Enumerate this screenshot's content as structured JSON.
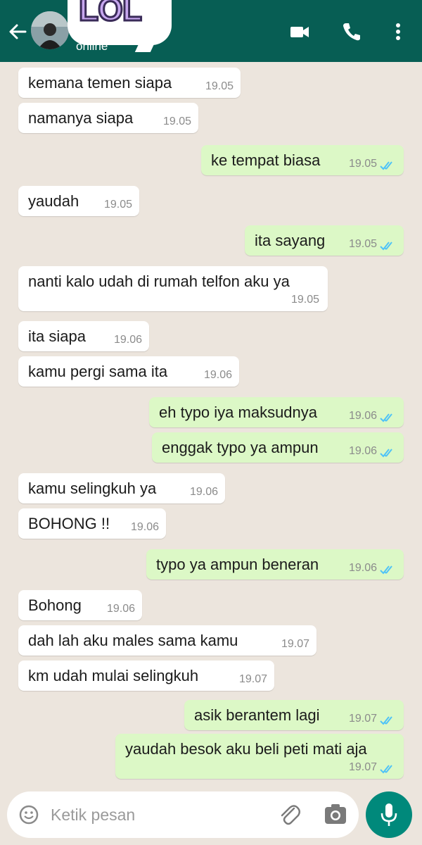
{
  "header": {
    "status": "online",
    "sticker_text": "LOL",
    "icons": [
      "back-arrow-icon",
      "video-call-icon",
      "voice-call-icon",
      "more-options-icon"
    ]
  },
  "messages": [
    {
      "dir": "in",
      "text": "kemana temen siapa",
      "time": "19.05"
    },
    {
      "dir": "in",
      "text": "namanya siapa",
      "time": "19.05"
    },
    {
      "dir": "out",
      "text": "ke tempat biasa",
      "time": "19.05"
    },
    {
      "dir": "in",
      "text": "yaudah",
      "time": "19.05"
    },
    {
      "dir": "out",
      "text": "ita sayang",
      "time": "19.05"
    },
    {
      "dir": "in",
      "text": "nanti kalo udah di rumah telfon aku ya",
      "time": "19.05"
    },
    {
      "dir": "in",
      "text": "ita siapa",
      "time": "19.06"
    },
    {
      "dir": "in",
      "text": "kamu pergi sama ita",
      "time": "19.06"
    },
    {
      "dir": "out",
      "text": "eh typo iya maksudnya",
      "time": "19.06"
    },
    {
      "dir": "out",
      "text": "enggak typo ya ampun",
      "time": "19.06"
    },
    {
      "dir": "in",
      "text": "kamu selingkuh ya",
      "time": "19.06"
    },
    {
      "dir": "in",
      "text": "BOHONG !!",
      "time": "19.06"
    },
    {
      "dir": "out",
      "text": "typo ya ampun beneran",
      "time": "19.06"
    },
    {
      "dir": "in",
      "text": "Bohong",
      "time": "19.06"
    },
    {
      "dir": "in",
      "text": "dah lah aku males sama kamu",
      "time": "19.07"
    },
    {
      "dir": "in",
      "text": "km udah mulai selingkuh",
      "time": "19.07"
    },
    {
      "dir": "out",
      "text": "asik berantem lagi",
      "time": "19.07"
    },
    {
      "dir": "out",
      "text": "yaudah besok aku beli peti mati aja",
      "time": "19.07"
    }
  ],
  "input": {
    "placeholder": "Ketik pesan",
    "icons": [
      "emoji-icon",
      "attach-icon",
      "camera-icon",
      "microphone-icon"
    ]
  },
  "colors": {
    "header": "#075e54",
    "chat_background": "#ece5dd",
    "incoming_bubble": "#ffffff",
    "outgoing_bubble": "#dcf8c6",
    "read_ticks": "#4fc3f7",
    "mic_button": "#00897b"
  }
}
